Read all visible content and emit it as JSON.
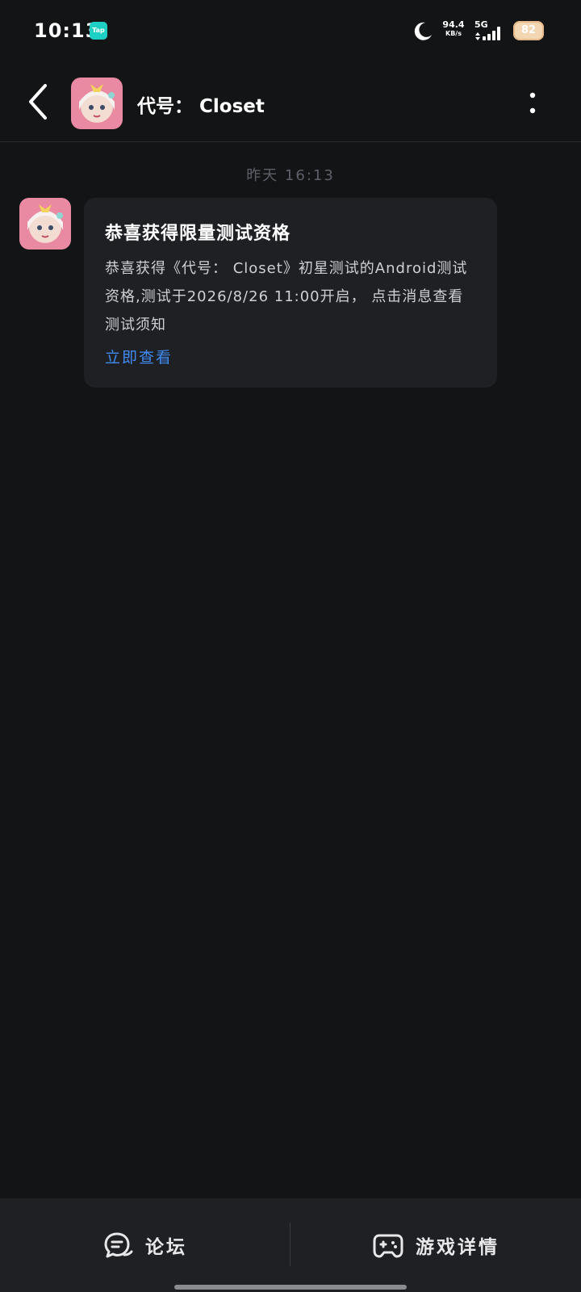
{
  "status_bar": {
    "time": "10:13",
    "app_badge": "Tap",
    "net_speed_value": "94.4",
    "net_speed_unit": "KB/s",
    "network_type": "5G",
    "battery": "82"
  },
  "header": {
    "title": "代号： Closet",
    "back_icon": "chevron-left-icon",
    "more_icon": "more-vertical-icon"
  },
  "chat": {
    "timestamp": "昨天  16:13",
    "message": {
      "title": "恭喜获得限量测试资格",
      "body": "恭喜获得《代号： Closet》初星测试的Android测试资格,测试于2026/8/26 11:00开启， 点击消息查看测试须知",
      "link": "立即查看"
    }
  },
  "bottom_bar": {
    "forum_label": "论坛",
    "game_detail_label": "游戏详情",
    "forum_icon": "chat-bubble-icon",
    "game_icon": "gamepad-icon"
  },
  "colors": {
    "background": "#131415",
    "card": "#1f2024",
    "link": "#3f8cf5",
    "muted_text": "#5d6068"
  }
}
